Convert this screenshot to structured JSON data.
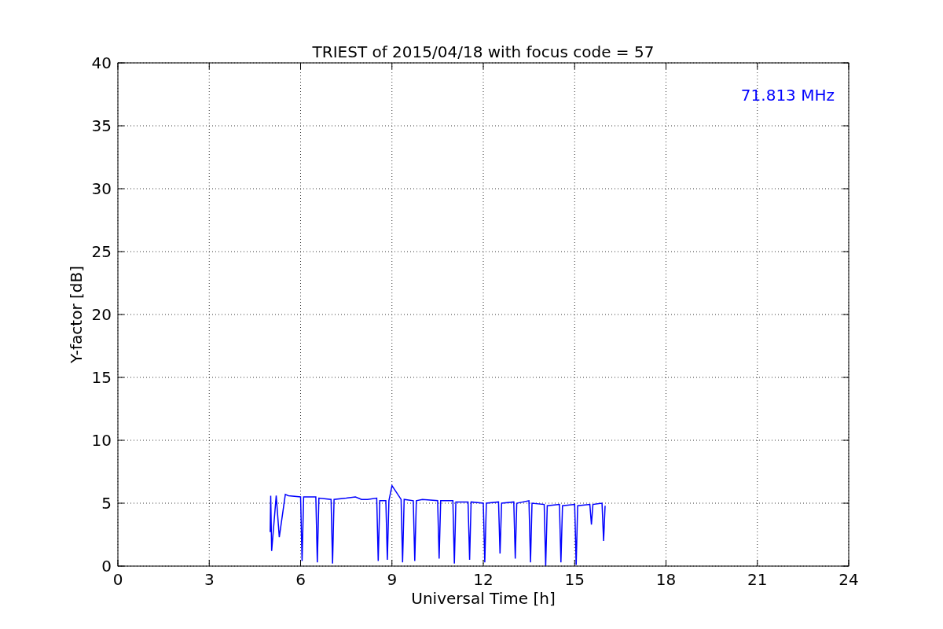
{
  "figure": {
    "chart_data": {
      "type": "line",
      "title": "TRIEST of 2015/04/18 with focus code = 57",
      "xlabel": "Universal Time [h]",
      "ylabel": "Y-factor [dB]",
      "x": [
        5.0,
        5.02,
        5.05,
        5.2,
        5.3,
        5.5,
        5.6,
        6.0,
        6.05,
        6.1,
        6.5,
        6.55,
        6.6,
        7.0,
        7.05,
        7.1,
        7.5,
        7.8,
        8.0,
        8.2,
        8.5,
        8.55,
        8.6,
        8.8,
        8.85,
        8.9,
        9.0,
        9.3,
        9.35,
        9.4,
        9.7,
        9.75,
        9.8,
        10.0,
        10.5,
        10.55,
        10.6,
        11.0,
        11.05,
        11.1,
        11.5,
        11.55,
        11.6,
        12.0,
        12.05,
        12.1,
        12.5,
        12.55,
        12.6,
        13.0,
        13.05,
        13.1,
        13.5,
        13.55,
        13.6,
        14.0,
        14.05,
        14.1,
        14.5,
        14.55,
        14.6,
        15.0,
        15.05,
        15.1,
        15.5,
        15.55,
        15.6,
        15.9,
        15.95,
        16.0
      ],
      "series": [
        {
          "color": "#0000ff",
          "values": [
            2.7,
            5.6,
            1.2,
            5.6,
            2.3,
            5.7,
            5.6,
            5.5,
            0.4,
            5.5,
            5.5,
            0.3,
            5.4,
            5.3,
            0.2,
            5.3,
            5.4,
            5.5,
            5.3,
            5.3,
            5.4,
            0.4,
            5.2,
            5.2,
            0.5,
            5.2,
            6.4,
            5.3,
            0.3,
            5.3,
            5.2,
            0.4,
            5.2,
            5.3,
            5.2,
            0.6,
            5.2,
            5.2,
            0.2,
            5.1,
            5.1,
            0.5,
            5.1,
            5.0,
            0.3,
            5.0,
            5.1,
            1.0,
            5.0,
            5.1,
            0.6,
            5.0,
            5.2,
            0.3,
            5.0,
            4.9,
            0.0,
            4.8,
            4.9,
            0.3,
            4.8,
            4.9,
            0.1,
            4.8,
            4.9,
            3.3,
            4.9,
            5.0,
            2.0,
            4.8
          ]
        }
      ],
      "xlim": [
        0,
        24
      ],
      "ylim": [
        0,
        40
      ],
      "xticks": [
        0,
        3,
        6,
        9,
        12,
        15,
        18,
        21,
        24
      ],
      "yticks": [
        0,
        5,
        10,
        15,
        20,
        25,
        30,
        35,
        40
      ],
      "grid": true,
      "annotations": [
        "71.813 MHz"
      ]
    }
  }
}
